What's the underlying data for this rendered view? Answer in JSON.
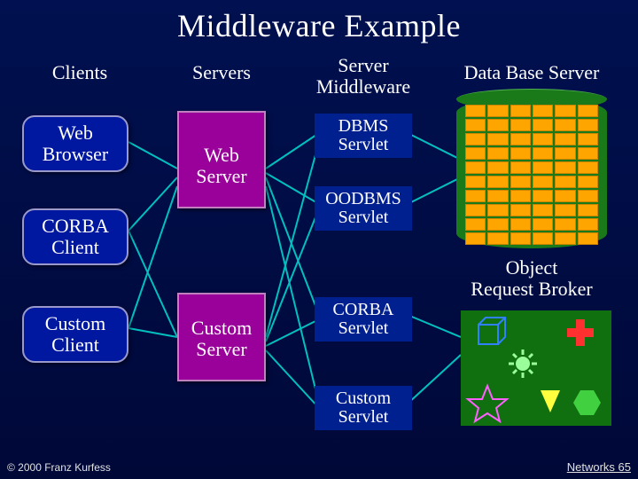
{
  "title": "Middleware Example",
  "columns": {
    "clients": "Clients",
    "servers": "Servers",
    "middleware": "Server\nMiddleware",
    "database": "Data Base Server"
  },
  "clients": [
    {
      "label": "Web\nBrowser"
    },
    {
      "label": "CORBA\nClient"
    },
    {
      "label": "Custom\nClient"
    }
  ],
  "servers": [
    {
      "label": "Web\nServer"
    },
    {
      "label": "Custom\nServer"
    }
  ],
  "servlets": [
    {
      "label": "DBMS\nServlet"
    },
    {
      "label": "OODBMS\nServlet"
    },
    {
      "label": "CORBA\nServlet"
    },
    {
      "label": "Custom\nServlet"
    }
  ],
  "orb_label": "Object\nRequest Broker",
  "orb_shapes": [
    "cube-icon",
    "plus-icon",
    "sun-icon",
    "star-icon",
    "triangle-down-icon",
    "hexagon-icon"
  ],
  "footer": "© 2000 Franz Kurfess",
  "page": "Networks  65",
  "colors": {
    "client_fill": "#0018a0",
    "server_fill": "#9a009a",
    "db_fill": "#1a7a1a",
    "cell_fill": "#ffa500",
    "line": "#00c0c0"
  }
}
